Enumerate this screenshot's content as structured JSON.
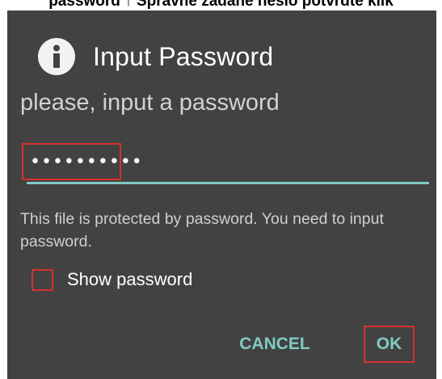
{
  "caption": "password ↑ Spravne zadane heslo potvrdte klik",
  "dialog": {
    "title": "Input Password",
    "title_icon": "info-icon",
    "prompt": "please, input a password",
    "password_value": "••••••••••",
    "description": "This file is protected by password. You need to input password.",
    "show_password_label": "Show password",
    "show_password_checked": false,
    "cancel_label": "CANCEL",
    "ok_label": "OK"
  },
  "colors": {
    "dialog_bg": "#424242",
    "accent": "#80cbc4",
    "highlight": "#d9302c"
  }
}
